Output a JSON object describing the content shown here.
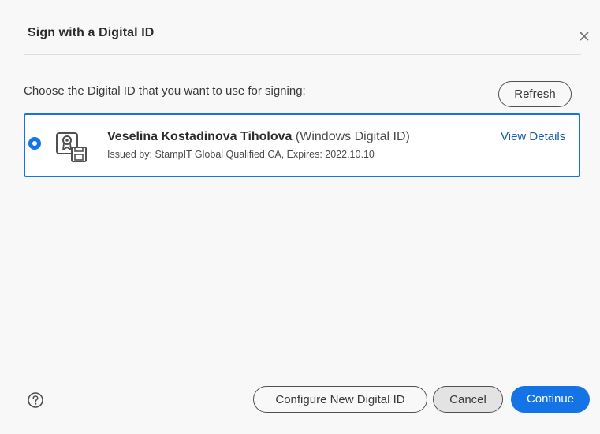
{
  "dialog": {
    "title": "Sign with a Digital ID",
    "prompt": "Choose the Digital ID that you want to use for signing:",
    "refresh_label": "Refresh"
  },
  "digital_ids": [
    {
      "name": "Veselina Kostadinova Tiholova",
      "type": "(Windows Digital ID)",
      "issued_line": "Issued by: StampIT Global Qualified CA, Expires: 2022.10.10",
      "selected": true,
      "details_label": "View Details",
      "icon": "certificate-icon"
    }
  ],
  "footer": {
    "help_icon": "help-icon",
    "configure_label": "Configure New Digital ID",
    "cancel_label": "Cancel",
    "continue_label": "Continue"
  },
  "colors": {
    "accent": "#1473e6",
    "link": "#1a5ea8",
    "background": "#f8f8f8"
  }
}
